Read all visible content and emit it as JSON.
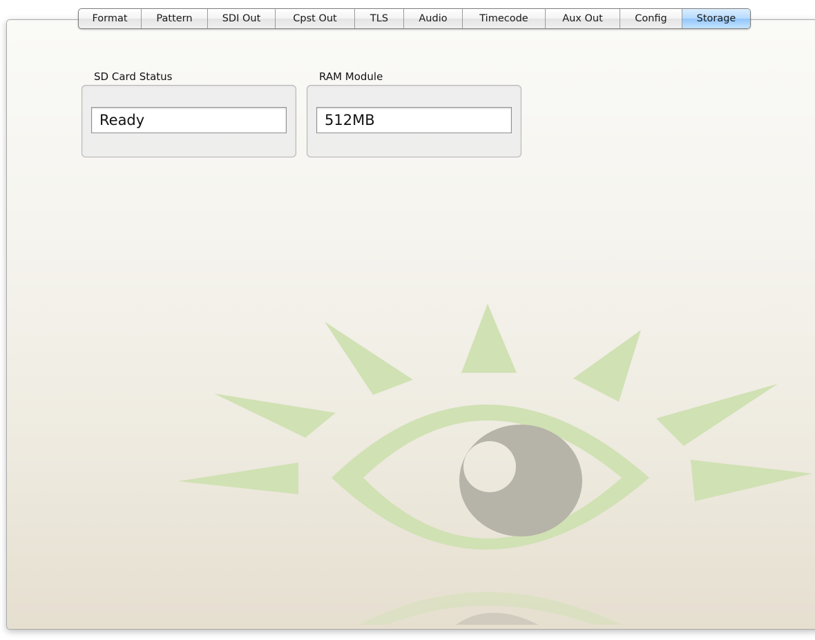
{
  "tabs": [
    {
      "label": "Format"
    },
    {
      "label": "Pattern"
    },
    {
      "label": "SDI Out"
    },
    {
      "label": "Cpst Out"
    },
    {
      "label": "TLS"
    },
    {
      "label": "Audio"
    },
    {
      "label": "Timecode"
    },
    {
      "label": "Aux Out"
    },
    {
      "label": "Config"
    },
    {
      "label": "Storage"
    }
  ],
  "active_tab": "Storage",
  "sd_card": {
    "label": "SD Card Status",
    "value": "Ready"
  },
  "ram_module": {
    "label": "RAM Module",
    "value": "512MB"
  },
  "colors": {
    "tab_active": "#a9d3fc",
    "watermark_green": "#cfe0b0",
    "watermark_gray": "#b5b2a8"
  },
  "watermark_icon": "eye-sunburst-logo"
}
